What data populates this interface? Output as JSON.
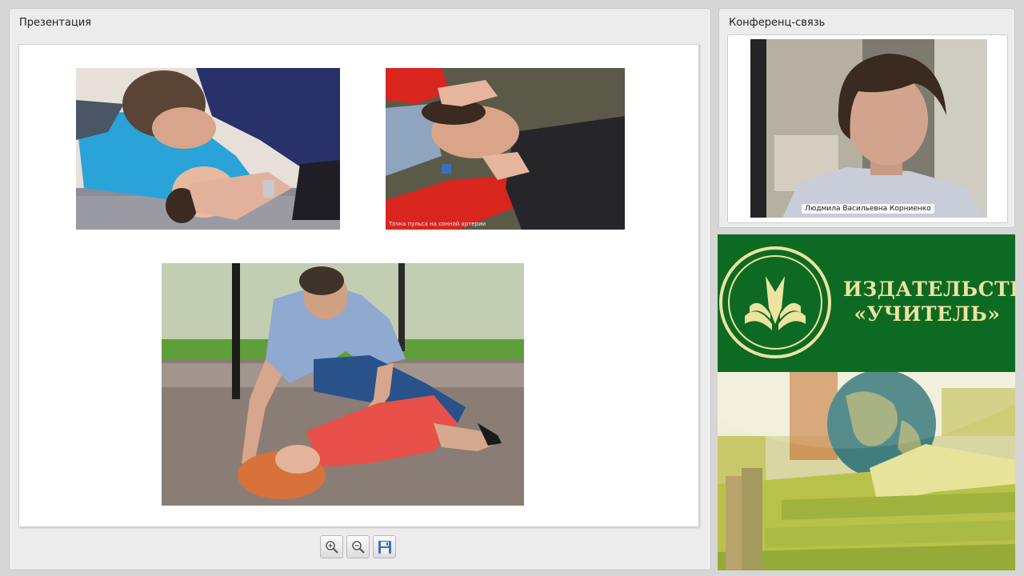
{
  "presentation": {
    "title": "Презентация",
    "slide": {
      "photos": [
        {
          "id": "photo-1",
          "caption": ""
        },
        {
          "id": "photo-2",
          "caption": "Точка пульса на сонной артерии"
        },
        {
          "id": "photo-3",
          "caption": ""
        }
      ]
    },
    "toolbar": [
      {
        "name": "zoom-in-button",
        "icon": "zoom-in-icon"
      },
      {
        "name": "zoom-out-button",
        "icon": "zoom-out-icon"
      },
      {
        "name": "save-button",
        "icon": "floppy-disk-icon"
      }
    ]
  },
  "conference": {
    "title": "Конференц-связь",
    "speaker_name": "Людмила Васильевна Корниенко"
  },
  "publisher": {
    "name_line1": "ИЗДАТЕЛЬСТВО",
    "name_line2": "«УЧИТЕЛЬ»",
    "colors": {
      "brand_green": "#0d6a23",
      "logo_gold": "#ece3a0"
    }
  }
}
